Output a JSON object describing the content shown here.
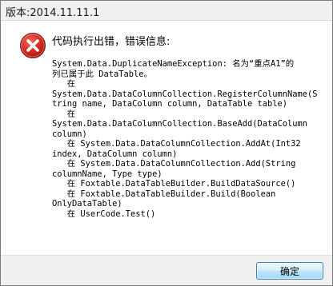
{
  "window": {
    "title": "版本:2014.11.11.1"
  },
  "dialog": {
    "icon": "error-icon",
    "heading": "代码执行出错，错误信息:",
    "body_lines": [
      "System.Data.DuplicateNameException: 名为“重点A1”的",
      "列已属于此 DataTable。",
      "   在",
      "System.Data.DataColumnCollection.RegisterColumnName(S",
      "tring name, DataColumn column, DataTable table)",
      "   在",
      "System.Data.DataColumnCollection.BaseAdd(DataColumn",
      "column)",
      "   在 System.Data.DataColumnCollection.AddAt(Int32",
      "index, DataColumn column)",
      "   在 System.Data.DataColumnCollection.Add(String",
      "columnName, Type type)",
      "   在 Foxtable.DataTableBuilder.BuildDataSource()",
      "   在 Foxtable.DataTableBuilder.Build(Boolean",
      "OnlyDataTable)",
      "   在 UserCode.Test()"
    ]
  },
  "footer": {
    "ok_label": "确定"
  },
  "colors": {
    "error_red": "#c8201d",
    "button_border": "#3c7fb1"
  }
}
